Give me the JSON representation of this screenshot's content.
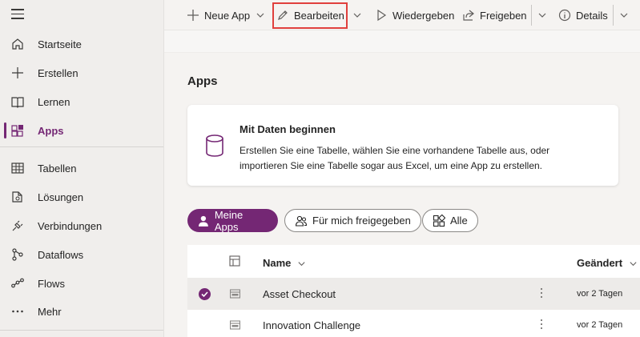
{
  "sidebar": {
    "items": [
      {
        "label": "Startseite",
        "icon": "home-icon"
      },
      {
        "label": "Erstellen",
        "icon": "plus-icon"
      },
      {
        "label": "Lernen",
        "icon": "book-icon"
      },
      {
        "label": "Apps",
        "icon": "apps-icon",
        "active": true
      },
      {
        "label": "Tabellen",
        "icon": "table-icon"
      },
      {
        "label": "Lösungen",
        "icon": "solutions-icon"
      },
      {
        "label": "Verbindungen",
        "icon": "plug-icon"
      },
      {
        "label": "Dataflows",
        "icon": "dataflow-icon"
      },
      {
        "label": "Flows",
        "icon": "flow-icon"
      },
      {
        "label": "Mehr",
        "icon": "more-icon"
      }
    ]
  },
  "toolbar": {
    "new_app": "Neue App",
    "edit": "Bearbeiten",
    "play": "Wiedergeben",
    "share": "Freigeben",
    "details": "Details"
  },
  "main": {
    "title": "Apps",
    "card": {
      "title": "Mit Daten beginnen",
      "description": "Erstellen Sie eine Tabelle, wählen Sie eine vorhandene Tabelle aus, oder importieren Sie eine Tabelle sogar aus Excel, um eine App zu erstellen."
    },
    "filters": {
      "my_apps": "Meine Apps",
      "shared": "Für mich freigegeben",
      "all": "Alle"
    },
    "table": {
      "col_name": "Name",
      "col_changed": "Geändert",
      "rows": [
        {
          "name": "Asset Checkout",
          "changed": "vor 2 Tagen",
          "selected": true
        },
        {
          "name": "Innovation Challenge",
          "changed": "vor 2 Tagen",
          "selected": false
        }
      ]
    }
  },
  "colors": {
    "accent": "#742774",
    "highlight": "#e0403d"
  }
}
